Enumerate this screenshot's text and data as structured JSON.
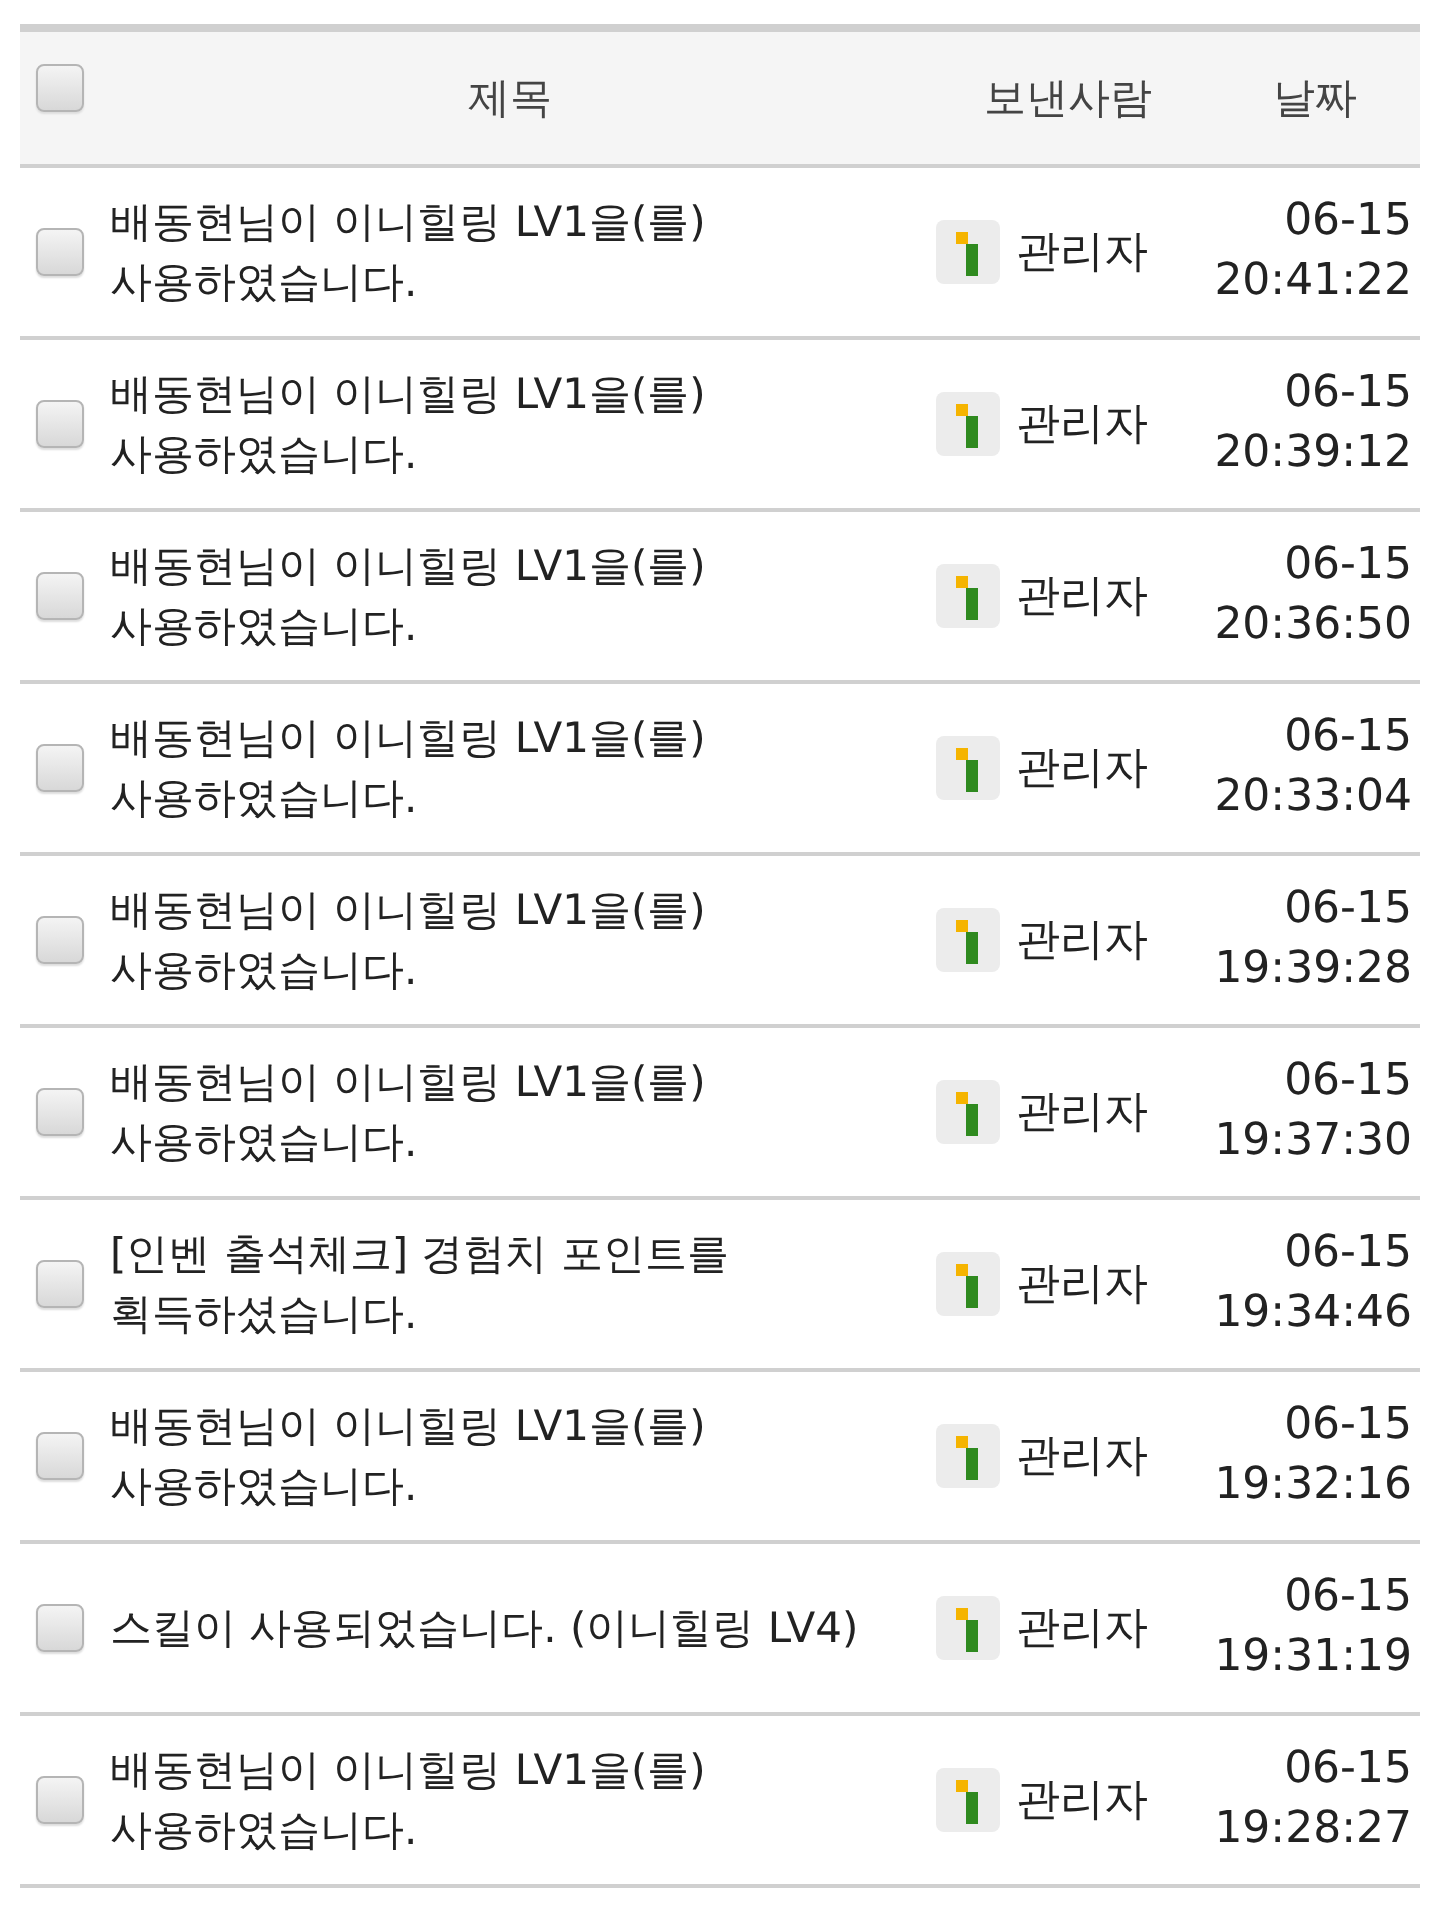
{
  "header": {
    "checked": false,
    "columns": [
      "제목",
      "보낸사람",
      "날짜"
    ]
  },
  "rows": [
    {
      "checked": false,
      "subject": "배동현님이 이니힐링 LV1을(를) 사용하였습니다.",
      "sender": "관리자",
      "date": "06-15",
      "time": "20:41:22"
    },
    {
      "checked": false,
      "subject": "배동현님이 이니힐링 LV1을(를) 사용하였습니다.",
      "sender": "관리자",
      "date": "06-15",
      "time": "20:39:12"
    },
    {
      "checked": false,
      "subject": "배동현님이 이니힐링 LV1을(를) 사용하였습니다.",
      "sender": "관리자",
      "date": "06-15",
      "time": "20:36:50"
    },
    {
      "checked": false,
      "subject": "배동현님이 이니힐링 LV1을(를) 사용하였습니다.",
      "sender": "관리자",
      "date": "06-15",
      "time": "20:33:04"
    },
    {
      "checked": false,
      "subject": "배동현님이 이니힐링 LV1을(를) 사용하였습니다.",
      "sender": "관리자",
      "date": "06-15",
      "time": "19:39:28"
    },
    {
      "checked": false,
      "subject": "배동현님이 이니힐링 LV1을(를) 사용하였습니다.",
      "sender": "관리자",
      "date": "06-15",
      "time": "19:37:30"
    },
    {
      "checked": false,
      "subject": "[인벤 출석체크] 경험치 포인트를 획득하셨습니다.",
      "sender": "관리자",
      "date": "06-15",
      "time": "19:34:46"
    },
    {
      "checked": false,
      "subject": "배동현님이 이니힐링 LV1을(를) 사용하였습니다.",
      "sender": "관리자",
      "date": "06-15",
      "time": "19:32:16"
    },
    {
      "checked": false,
      "subject": "스킬이 사용되었습니다. (이니힐링 LV4)",
      "sender": "관리자",
      "date": "06-15",
      "time": "19:31:19"
    },
    {
      "checked": false,
      "subject": "배동현님이 이니힐링 LV1을(를) 사용하였습니다.",
      "sender": "관리자",
      "date": "06-15",
      "time": "19:28:27"
    }
  ]
}
